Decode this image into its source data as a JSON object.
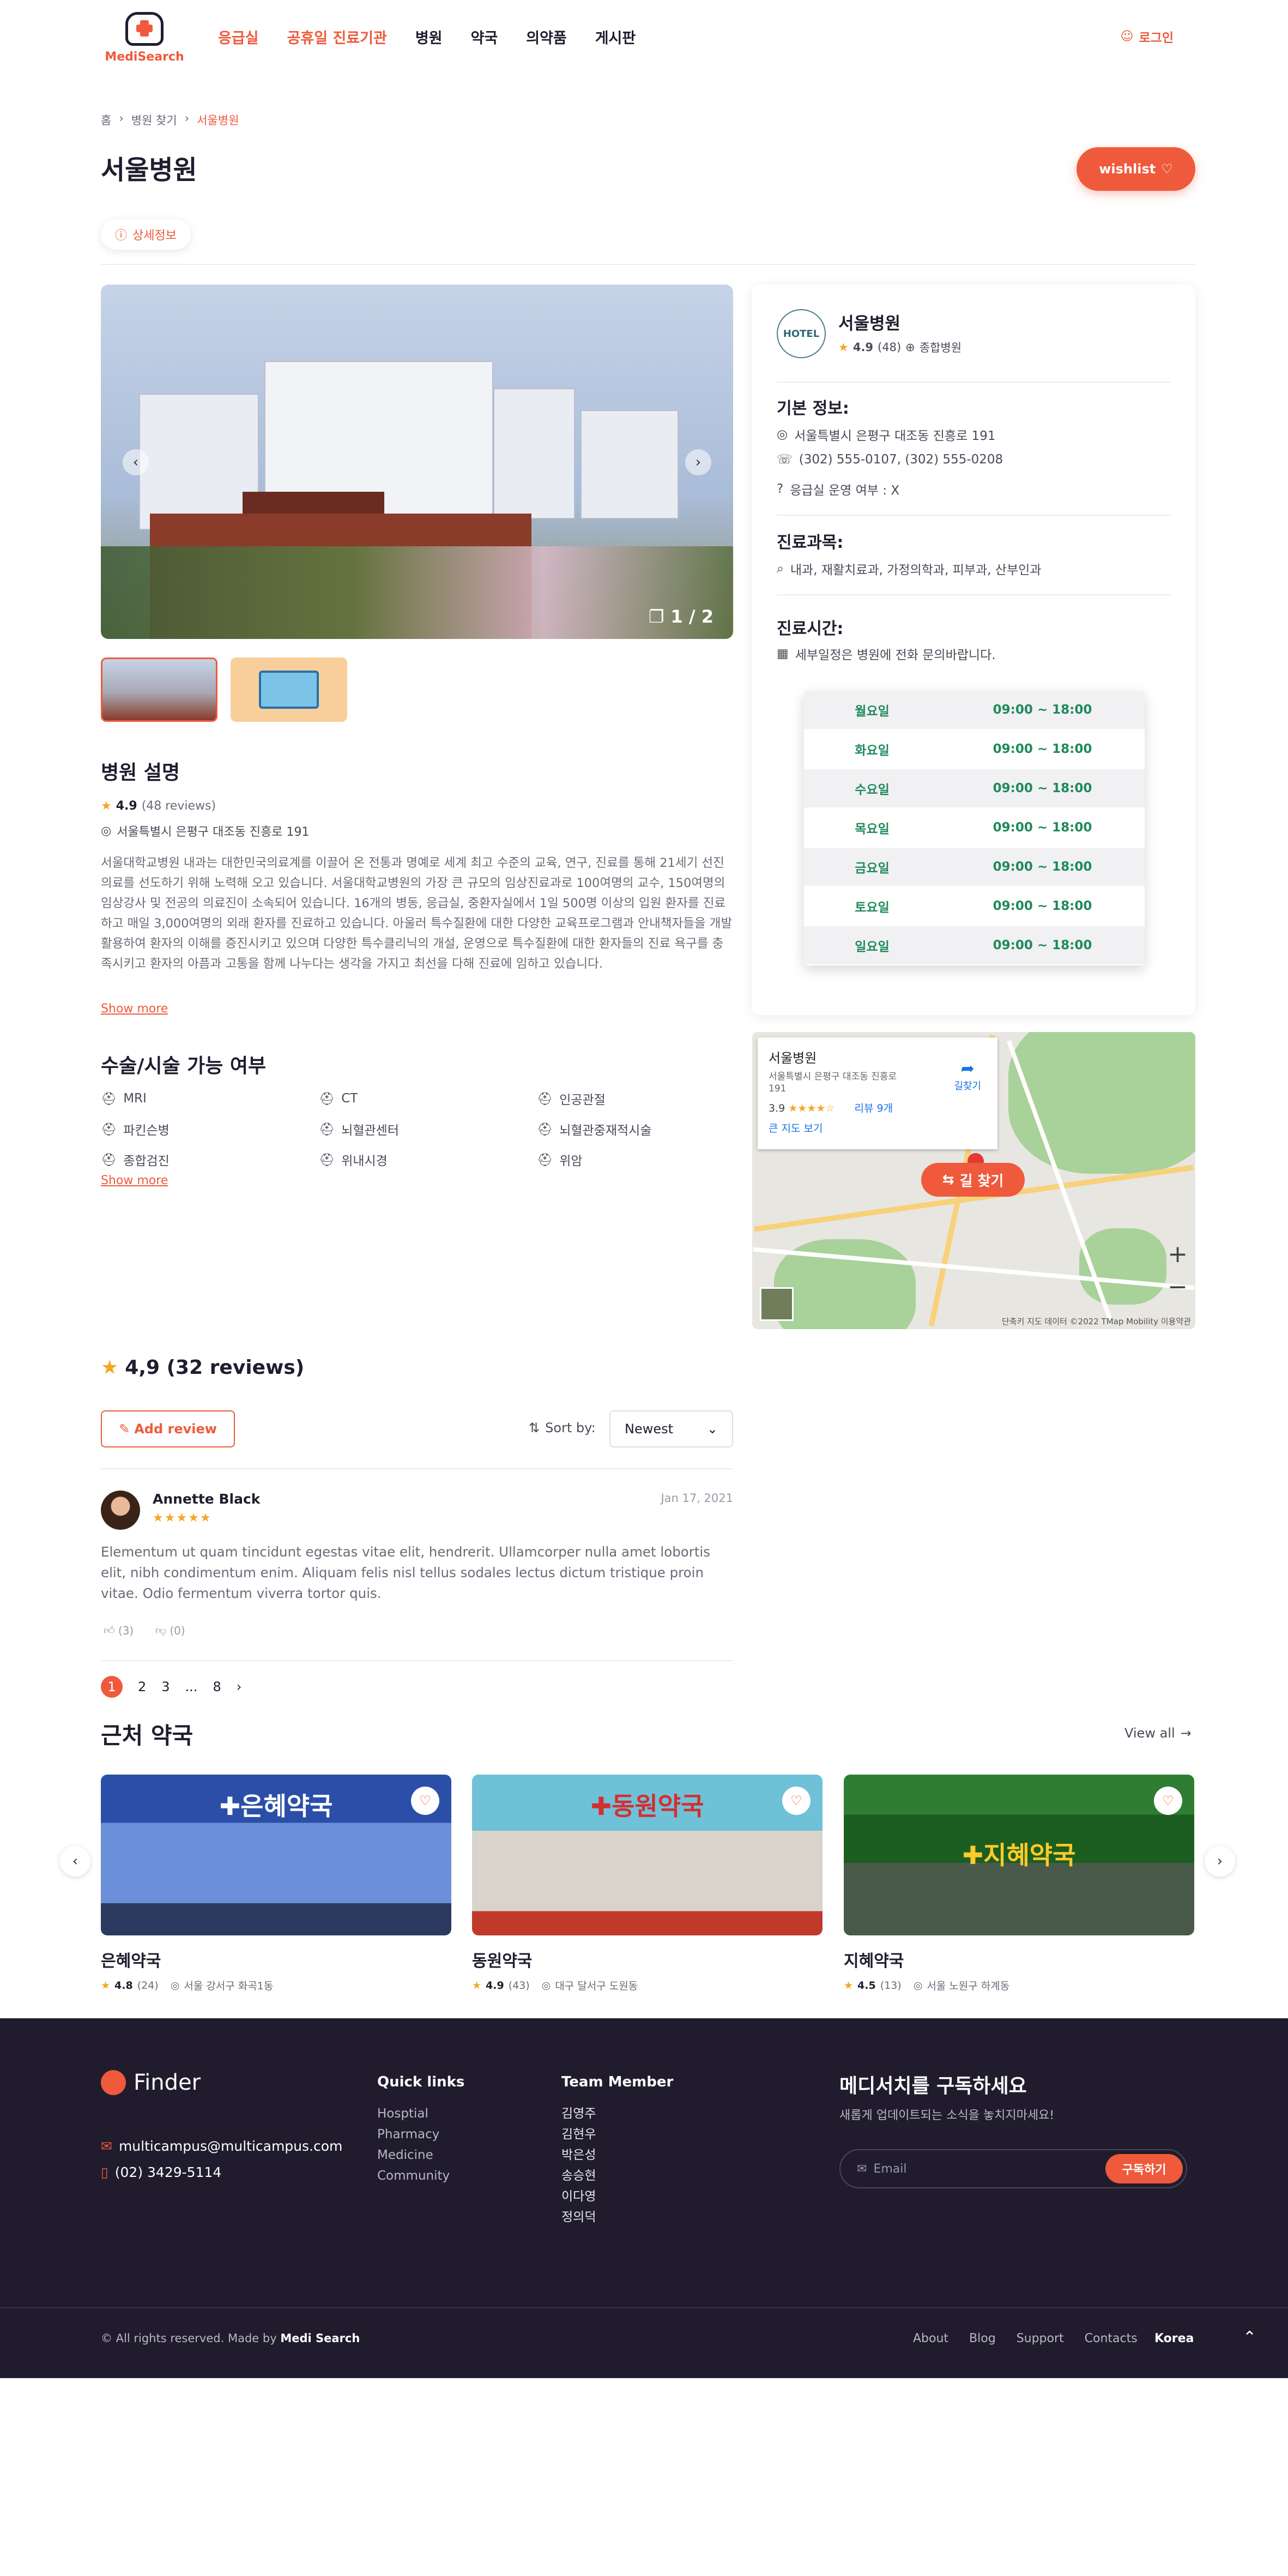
{
  "header": {
    "logo_text": "MediSearch",
    "nav": [
      "응급실",
      "공휴일 진료기관",
      "병원",
      "약국",
      "의약품",
      "게시판"
    ],
    "login": "로그인"
  },
  "breadcrumb": [
    "홈",
    "병원 찾기",
    "서울병원"
  ],
  "page": {
    "title": "서울병원",
    "wishlist": "wishlist",
    "tab_detail": "상세정보"
  },
  "gallery": {
    "counter": "1 / 2"
  },
  "description": {
    "heading": "병원 설명",
    "rating": "4.9",
    "reviews_count": "(48 reviews)",
    "address": "서울특별시 은평구 대조동 진흥로 191",
    "text": "서울대학교병원 내과는 대한민국의료계를 이끌어 온 전통과 명예로 세계 최고 수준의 교육, 연구, 진료를 통해 21세기 선진 의료를 선도하기 위해 노력해 오고 있습니다. 서울대학교병원의 가장 큰 규모의 임상진료과로 100여명의 교수, 150여명의 임상강사 및 전공의 의료진이 소속되어 있습니다. 16개의 병동, 응급실, 중환자실에서 1일 500명 이상의 입원 환자를 진료하고 매일 3,000여명의 외래 환자를 진료하고 있습니다. 아울러 특수질환에 대한 다양한 교육프로그램과 안내책자들을 개발 활용하여 환자의 이해를 증진시키고 있으며 다양한 특수클리닉의 개설, 운영으로 특수질환에 대한 환자들의 진료 욕구를 충족시키고 환자의 아픔과 고통을 함께 나누다는 생각을 가지고 최선을 다해 진료에 임하고 있습니다.",
    "show_more": "Show more"
  },
  "procedures": {
    "heading": "수술/시술 가능 여부",
    "items": [
      "MRI",
      "CT",
      "인공관절",
      "파킨슨병",
      "뇌혈관센터",
      "뇌혈관중재적시술",
      "종합검진",
      "위내시경",
      "위암"
    ],
    "show_more": "Show more"
  },
  "card": {
    "logo_text": "HOTEL",
    "name": "서울병원",
    "rating": "4.9",
    "reviews": "(48)",
    "type": "종합병원",
    "basic_heading": "기본 정보:",
    "address": "서울특별시 은평구 대조동 진흥로 191",
    "phone": "(302) 555-0107, (302) 555-0208",
    "er": "응급실 운영 여부 : X",
    "dept_heading": "진료과목:",
    "departments": "내과, 재활치료과, 가정의학과, 피부과, 산부인과",
    "hours_heading": "진료시간:",
    "hours_note": "세부일정은 병원에 전화 문의바랍니다.",
    "schedule": [
      {
        "day": "월요일",
        "time": "09:00 ~ 18:00"
      },
      {
        "day": "화요일",
        "time": "09:00 ~ 18:00"
      },
      {
        "day": "수요일",
        "time": "09:00 ~ 18:00"
      },
      {
        "day": "목요일",
        "time": "09:00 ~ 18:00"
      },
      {
        "day": "금요일",
        "time": "09:00 ~ 18:00"
      },
      {
        "day": "토요일",
        "time": "09:00 ~ 18:00"
      },
      {
        "day": "일요일",
        "time": "09:00 ~ 18:00"
      }
    ]
  },
  "map": {
    "title": "서울병원",
    "address": "서울특별시 은평구 대조동 진흥로 191",
    "rating": "3.9",
    "stars": "★★★★☆",
    "reviews": "리뷰 9개",
    "large_map": "큰 지도 보기",
    "directions": "길찾기",
    "button": "길 찾기",
    "footer": "단축키  지도 데이터 ©2022 TMap Mobility  이용약관"
  },
  "reviews": {
    "summary": "4,9 (32 reviews)",
    "add": "Add review",
    "sort_label": "Sort by:",
    "sort_value": "Newest",
    "item": {
      "name": "Annette Black",
      "stars": "★★★★★",
      "date": "Jan 17, 2021",
      "text": "Elementum ut quam tincidunt egestas vitae elit, hendrerit. Ullamcorper nulla amet lobortis elit, nibh condimentum enim. Aliquam felis nisl tellus sodales lectus dictum tristique proin vitae. Odio fermentum viverra tortor quis.",
      "likes": "(3)",
      "dislikes": "(0)"
    },
    "pages": [
      "1",
      "2",
      "3",
      "...",
      "8"
    ]
  },
  "pharmacies": {
    "heading": "근처 약국",
    "view_all": "View all",
    "items": [
      {
        "name": "은혜약국",
        "sign": "✚은혜약국",
        "rating": "4.8",
        "count": "(24)",
        "address": "서울 강서구 화곡1동"
      },
      {
        "name": "동원약국",
        "sign": "✚동원약국",
        "rating": "4.9",
        "count": "(43)",
        "address": "대구 달서구 도원동"
      },
      {
        "name": "지혜약국",
        "sign": "✚지혜약국",
        "rating": "4.5",
        "count": "(13)",
        "address": "서울 노원구 하계동"
      }
    ]
  },
  "footer": {
    "logo": "Finder",
    "email": "multicampus@multicampus.com",
    "phone": "(02) 3429-5114",
    "quick_heading": "Quick links",
    "quick": [
      "Hosptial",
      "Pharmacy",
      "Medicine",
      "Community"
    ],
    "team_heading": "Team Member",
    "team": [
      "김영주",
      "김현우",
      "박은성",
      "송승현",
      "이다영",
      "정의덕"
    ],
    "subscribe_heading": "메디서치를 구독하세요",
    "subscribe_text": "새롭게 업데이트되는 소식을 놓치지마세요!",
    "email_placeholder": "Email",
    "subscribe_btn": "구독하기",
    "copyright_pre": "© All rights reserved. Made by",
    "copyright_brand": "Medi Search",
    "links": [
      "About",
      "Blog",
      "Support",
      "Contacts"
    ],
    "lang": "Korea"
  }
}
